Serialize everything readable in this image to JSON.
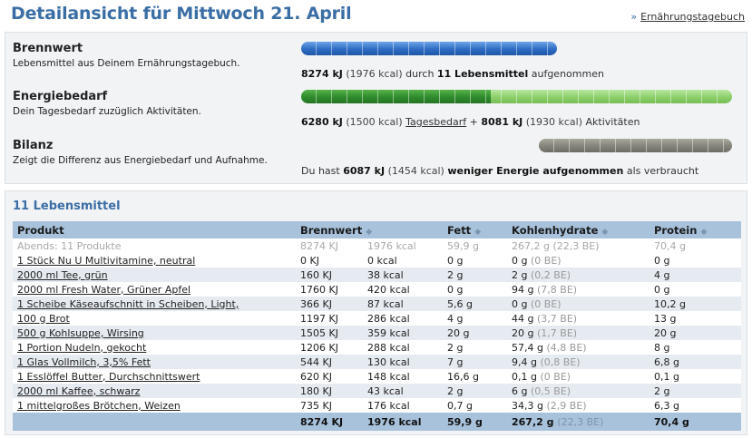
{
  "header": {
    "title": "Detailansicht für Mittwoch 21. April",
    "diary_arrow": "»",
    "diary_link": "Ernährungstagebuch"
  },
  "summary": {
    "brennwert": {
      "label": "Brennwert",
      "description": "Lebensmittel aus Deinem Ernährungstagebuch.",
      "kj": "8274 kJ",
      "kcal": "(1976 kcal)",
      "mid": "durch",
      "count": "11 Lebensmittel",
      "suffix": "aufgenommen"
    },
    "energiebedarf": {
      "label": "Energiebedarf",
      "description": "Dein Tagesbedarf zuzüglich Aktivitäten.",
      "kj": "6280 kJ",
      "kcal": "(1500 kcal)",
      "link": "Tagesbedarf",
      "plus": "+",
      "kj2": "8081 kJ",
      "kcal2": "(1930 kcal)",
      "suffix": "Aktivitäten",
      "fill_fraction": 0.44
    },
    "bilanz": {
      "label": "Bilanz",
      "description": "Zeigt die Differenz aus Energiebedarf und Aufnahme.",
      "prefix": "Du hast",
      "kj": "6087 kJ",
      "kcal": "(1454 kcal)",
      "bold": "weniger Energie aufgenommen",
      "suffix": "als verbraucht"
    },
    "colors": {
      "blue": "#2e6cc3",
      "green": "#2e8b2c",
      "green_light": "#8ccf6a",
      "gray": "#83837a"
    }
  },
  "foods": {
    "title": "11 Lebensmittel",
    "columns": {
      "product": "Produkt",
      "energy": "Brennwert",
      "fat": "Fett",
      "carbs": "Kohlenhydrate",
      "protein": "Protein"
    },
    "subheader": {
      "label": "Abends: 11 Produkte",
      "kj": "8274 KJ",
      "kcal": "1976 kcal",
      "fat": "59,9 g",
      "carbs": "267,2 g",
      "be": "(22,3 BE)",
      "protein": "70,4 g"
    },
    "rows": [
      {
        "product": "1 Stück Nu U Multivitamine, neutral",
        "kj": "0 KJ",
        "kcal": "0 kcal",
        "fat": "0 g",
        "carbs": "0 g",
        "be": "(0 BE)",
        "protein": "0 g"
      },
      {
        "product": "2000 ml Tee, grün",
        "kj": "160 KJ",
        "kcal": "38 kcal",
        "fat": "2 g",
        "carbs": "2 g",
        "be": "(0,2 BE)",
        "protein": "4 g"
      },
      {
        "product": "2000 ml Fresh Water, Grüner Apfel",
        "kj": "1760 KJ",
        "kcal": "420 kcal",
        "fat": "0 g",
        "carbs": "94 g",
        "be": "(7,8 BE)",
        "protein": "0 g"
      },
      {
        "product": "1 Scheibe Käseaufschnitt in Scheiben, Light,",
        "kj": "366 KJ",
        "kcal": "87 kcal",
        "fat": "5,6 g",
        "carbs": "0 g",
        "be": "(0 BE)",
        "protein": "10,2 g"
      },
      {
        "product": "100 g Brot",
        "kj": "1197 KJ",
        "kcal": "286 kcal",
        "fat": "4 g",
        "carbs": "44 g",
        "be": "(3,7 BE)",
        "protein": "13 g"
      },
      {
        "product": "500 g Kohlsuppe, Wirsing",
        "kj": "1505 KJ",
        "kcal": "359 kcal",
        "fat": "20 g",
        "carbs": "20 g",
        "be": "(1,7 BE)",
        "protein": "20 g"
      },
      {
        "product": "1 Portion Nudeln, gekocht",
        "kj": "1206 KJ",
        "kcal": "288 kcal",
        "fat": "2 g",
        "carbs": "57,4 g",
        "be": "(4,8 BE)",
        "protein": "8 g"
      },
      {
        "product": "1 Glas Vollmilch, 3,5% Fett",
        "kj": "544 KJ",
        "kcal": "130 kcal",
        "fat": "7 g",
        "carbs": "9,4 g",
        "be": "(0,8 BE)",
        "protein": "6,8 g"
      },
      {
        "product": "1 Esslöffel Butter, Durchschnittswert",
        "kj": "620 KJ",
        "kcal": "148 kcal",
        "fat": "16,6 g",
        "carbs": "0,1 g",
        "be": "(0 BE)",
        "protein": "0,1 g"
      },
      {
        "product": "2000 ml Kaffee, schwarz",
        "kj": "180 KJ",
        "kcal": "43 kcal",
        "fat": "2 g",
        "carbs": "6 g",
        "be": "(0,5 BE)",
        "protein": "2 g"
      },
      {
        "product": "1 mittelgroßes Brötchen, Weizen",
        "kj": "735 KJ",
        "kcal": "176 kcal",
        "fat": "0,7 g",
        "carbs": "34,3 g",
        "be": "(2,9 BE)",
        "protein": "6,3 g"
      }
    ],
    "total": {
      "kj": "8274 KJ",
      "kcal": "1976 kcal",
      "fat": "59,9 g",
      "carbs": "267,2 g",
      "be": "(22,3 BE)",
      "protein": "70,4 g"
    }
  }
}
